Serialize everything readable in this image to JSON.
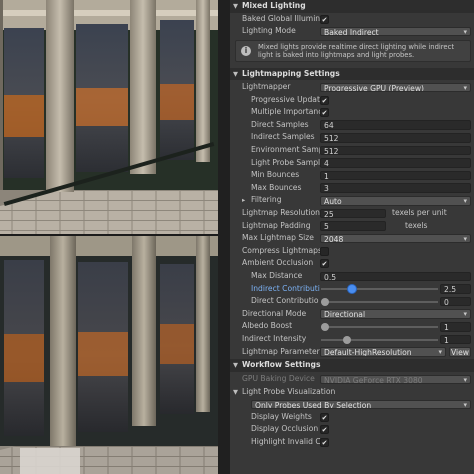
{
  "mixed_lighting": {
    "title": "Mixed Lighting",
    "baked_gi": {
      "label": "Baked Global Illumin",
      "checked": true
    },
    "lighting_mode": {
      "label": "Lighting Mode",
      "value": "Baked Indirect"
    },
    "info": "Mixed lights provide realtime direct lighting while indirect light is baked into lightmaps and light probes."
  },
  "lightmapping": {
    "title": "Lightmapping Settings",
    "lightmapper": {
      "label": "Lightmapper",
      "value": "Progressive GPU (Preview)"
    },
    "progressive_updates": {
      "label": "Progressive Updat",
      "checked": true
    },
    "multiple_importance": {
      "label": "Multiple Importanc",
      "checked": true
    },
    "direct_samples": {
      "label": "Direct Samples",
      "value": "64"
    },
    "indirect_samples": {
      "label": "Indirect Samples",
      "value": "512"
    },
    "environment_samples": {
      "label": "Environment Samp",
      "value": "512"
    },
    "light_probe_samples": {
      "label": "Light Probe Sampl",
      "value": "4"
    },
    "min_bounces": {
      "label": "Min Bounces",
      "value": "1"
    },
    "max_bounces": {
      "label": "Max Bounces",
      "value": "3"
    },
    "filtering": {
      "label": "Filtering",
      "value": "Auto"
    },
    "lightmap_resolution": {
      "label": "Lightmap Resolution",
      "value": "25",
      "unit": "texels per unit"
    },
    "lightmap_padding": {
      "label": "Lightmap Padding",
      "value": "5",
      "unit": "texels"
    },
    "max_lightmap_size": {
      "label": "Max Lightmap Size",
      "value": "2048"
    },
    "compress_lightmaps": {
      "label": "Compress Lightmaps",
      "checked": false
    },
    "ambient_occlusion": {
      "label": "Ambient Occlusion",
      "checked": true
    },
    "max_distance": {
      "label": "Max Distance",
      "value": "0.5"
    },
    "indirect_contribution": {
      "label": "Indirect Contributi",
      "value": "2.5",
      "slider_fraction": 0.25
    },
    "direct_contribution": {
      "label": "Direct Contributio",
      "value": "0",
      "slider_fraction": 0.0
    },
    "directional_mode": {
      "label": "Directional Mode",
      "value": "Directional"
    },
    "albedo_boost": {
      "label": "Albedo Boost",
      "value": "1",
      "slider_fraction": 0.0
    },
    "indirect_intensity": {
      "label": "Indirect Intensity",
      "value": "1",
      "slider_fraction": 0.2
    },
    "lightmap_parameters": {
      "label": "Lightmap Parameters",
      "value": "Default-HighResolution",
      "button": "View"
    }
  },
  "workflow": {
    "title": "Workflow Settings",
    "gpu_baking_device": {
      "label": "GPU Baking Device",
      "value": "NVIDIA GeForce RTX 3080"
    },
    "light_probe_vis": {
      "label": "Light Probe Visualization",
      "expanded": true
    },
    "probe_filter": {
      "value": "Only Probes Used By Selection"
    },
    "display_weights": {
      "label": "Display Weights",
      "checked": true
    },
    "display_occlusion": {
      "label": "Display Occlusion",
      "checked": true
    },
    "highlight_invalid": {
      "label": "Highlight Invalid C",
      "checked": true
    }
  },
  "icons": {
    "fold": "triangle-down-icon",
    "info": "info-icon",
    "check": "checkmark-icon"
  },
  "colors": {
    "accent": "#4a8ef0",
    "panel": "#383838",
    "header": "#2d2d2d"
  }
}
